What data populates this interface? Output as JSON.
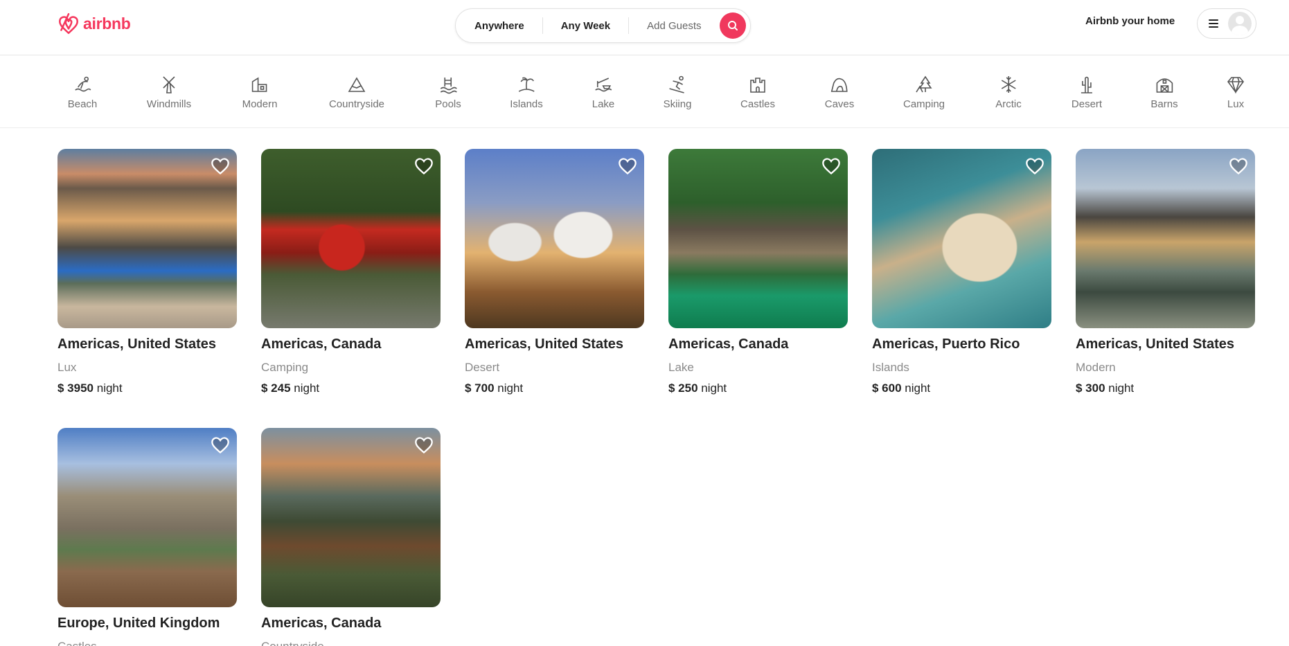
{
  "brand": {
    "name": "airbnb",
    "color": "#f5385d"
  },
  "search": {
    "where": "Anywhere",
    "when": "Any Week",
    "guests": "Add Guests",
    "button_icon": "search-icon"
  },
  "header": {
    "host_link": "Airbnb your home",
    "menu_icon": "hamburger-icon",
    "avatar_icon": "user-avatar-icon"
  },
  "categories": [
    {
      "label": "Beach",
      "icon": "beach-icon"
    },
    {
      "label": "Windmills",
      "icon": "windmill-icon"
    },
    {
      "label": "Modern",
      "icon": "modern-house-icon"
    },
    {
      "label": "Countryside",
      "icon": "mountain-icon"
    },
    {
      "label": "Pools",
      "icon": "pool-icon"
    },
    {
      "label": "Islands",
      "icon": "island-icon"
    },
    {
      "label": "Lake",
      "icon": "lake-icon"
    },
    {
      "label": "Skiing",
      "icon": "skiing-icon"
    },
    {
      "label": "Castles",
      "icon": "castle-icon"
    },
    {
      "label": "Caves",
      "icon": "cave-icon"
    },
    {
      "label": "Camping",
      "icon": "camping-icon"
    },
    {
      "label": "Arctic",
      "icon": "snowflake-icon"
    },
    {
      "label": "Desert",
      "icon": "cactus-icon"
    },
    {
      "label": "Barns",
      "icon": "barn-icon"
    },
    {
      "label": "Lux",
      "icon": "diamond-icon"
    }
  ],
  "listings": [
    {
      "location": "Americas, United States",
      "type": "Lux",
      "price": "$ 3950",
      "unit": "night"
    },
    {
      "location": "Americas, Canada",
      "type": "Camping",
      "price": "$ 245",
      "unit": "night"
    },
    {
      "location": "Americas, United States",
      "type": "Desert",
      "price": "$ 700",
      "unit": "night"
    },
    {
      "location": "Americas, Canada",
      "type": "Lake",
      "price": "$ 250",
      "unit": "night"
    },
    {
      "location": "Americas, Puerto Rico",
      "type": "Islands",
      "price": "$ 600",
      "unit": "night"
    },
    {
      "location": "Americas, United States",
      "type": "Modern",
      "price": "$ 300",
      "unit": "night"
    },
    {
      "location": "Europe, United Kingdom",
      "type": "Castles",
      "price": "",
      "unit": ""
    },
    {
      "location": "Americas, Canada",
      "type": "Countryside",
      "price": "",
      "unit": ""
    }
  ]
}
